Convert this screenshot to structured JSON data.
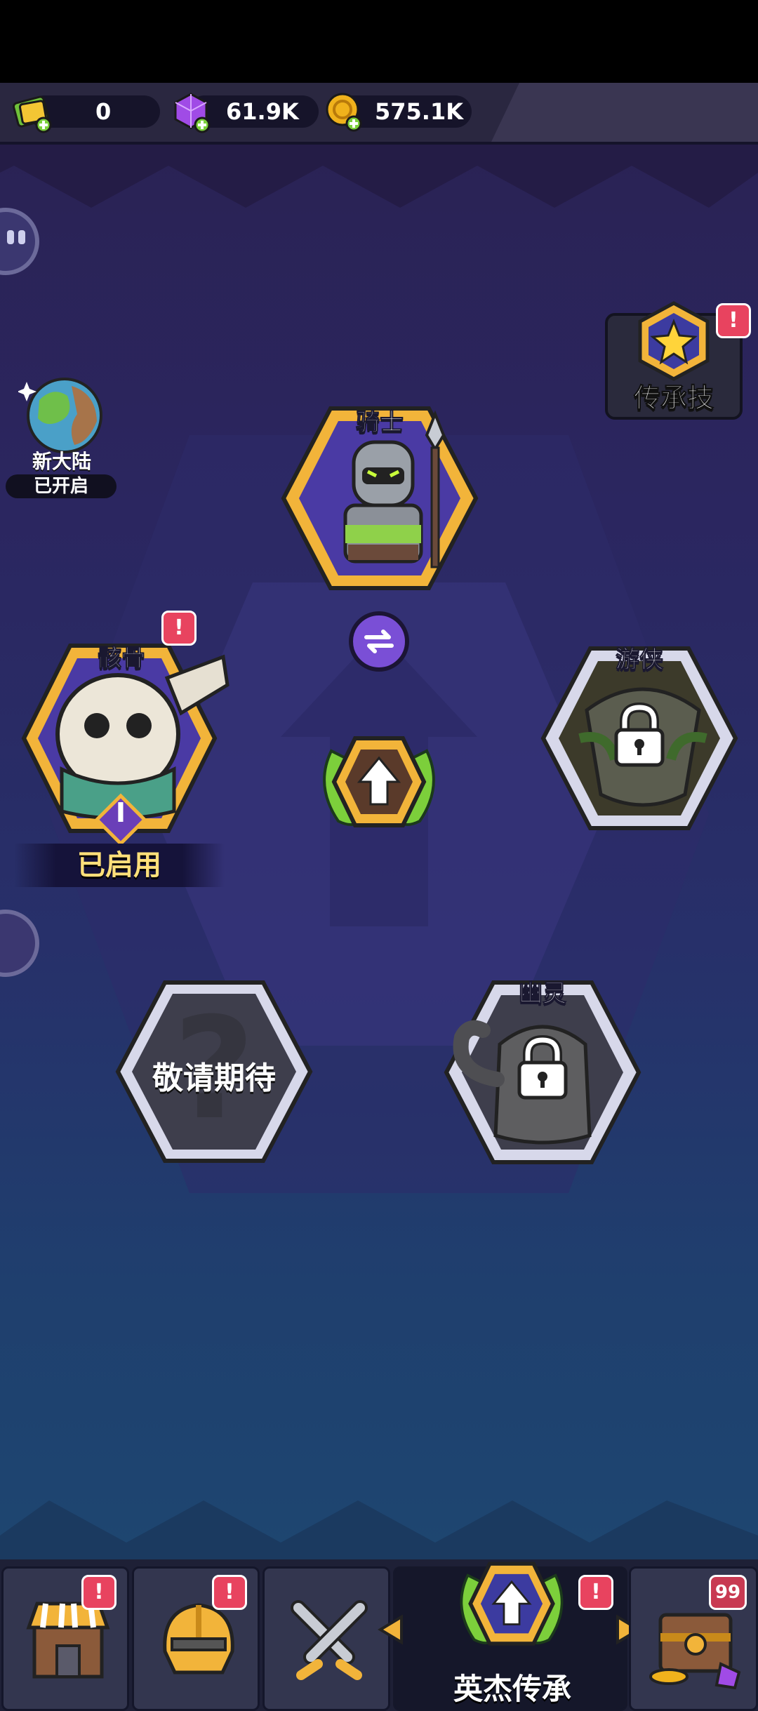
{
  "resources": [
    {
      "name": "ticket",
      "value": "0",
      "icon": "ticket-icon",
      "color": "#7ccf3b"
    },
    {
      "name": "gem",
      "value": "61.9K",
      "icon": "gem-icon",
      "color": "#a04be6"
    },
    {
      "name": "coin",
      "value": "575.1K",
      "icon": "coin-icon",
      "color": "#f0b21c"
    }
  ],
  "left_panel": {
    "title": "新大陆",
    "status": "已开启"
  },
  "legacy_skill": {
    "label": "传承技"
  },
  "heroes": [
    {
      "id": "knight",
      "name": "骑士",
      "state": "selected"
    },
    {
      "id": "skeleton",
      "name": "骸骨",
      "state": "active",
      "tier": "I",
      "status": "已启用"
    },
    {
      "id": "ranger",
      "name": "游侠",
      "state": "locked"
    },
    {
      "id": "ghost",
      "name": "幽灵",
      "state": "locked"
    },
    {
      "id": "coming",
      "name": "敬请期待",
      "state": "coming-soon"
    }
  ],
  "nav": {
    "tabs": [
      {
        "id": "shop",
        "icon": "shop-icon"
      },
      {
        "id": "hero",
        "icon": "helmet-icon"
      },
      {
        "id": "battle",
        "icon": "crossed-swords-icon"
      },
      {
        "id": "legacy",
        "icon": "upgrade-emblem-icon",
        "label": "英杰传承",
        "active": true
      },
      {
        "id": "chest",
        "icon": "treasure-chest-icon",
        "count": "99"
      }
    ]
  },
  "colors": {
    "accent": "#f2b43a",
    "alert": "#e8435f",
    "locked": "#4a4a55"
  }
}
